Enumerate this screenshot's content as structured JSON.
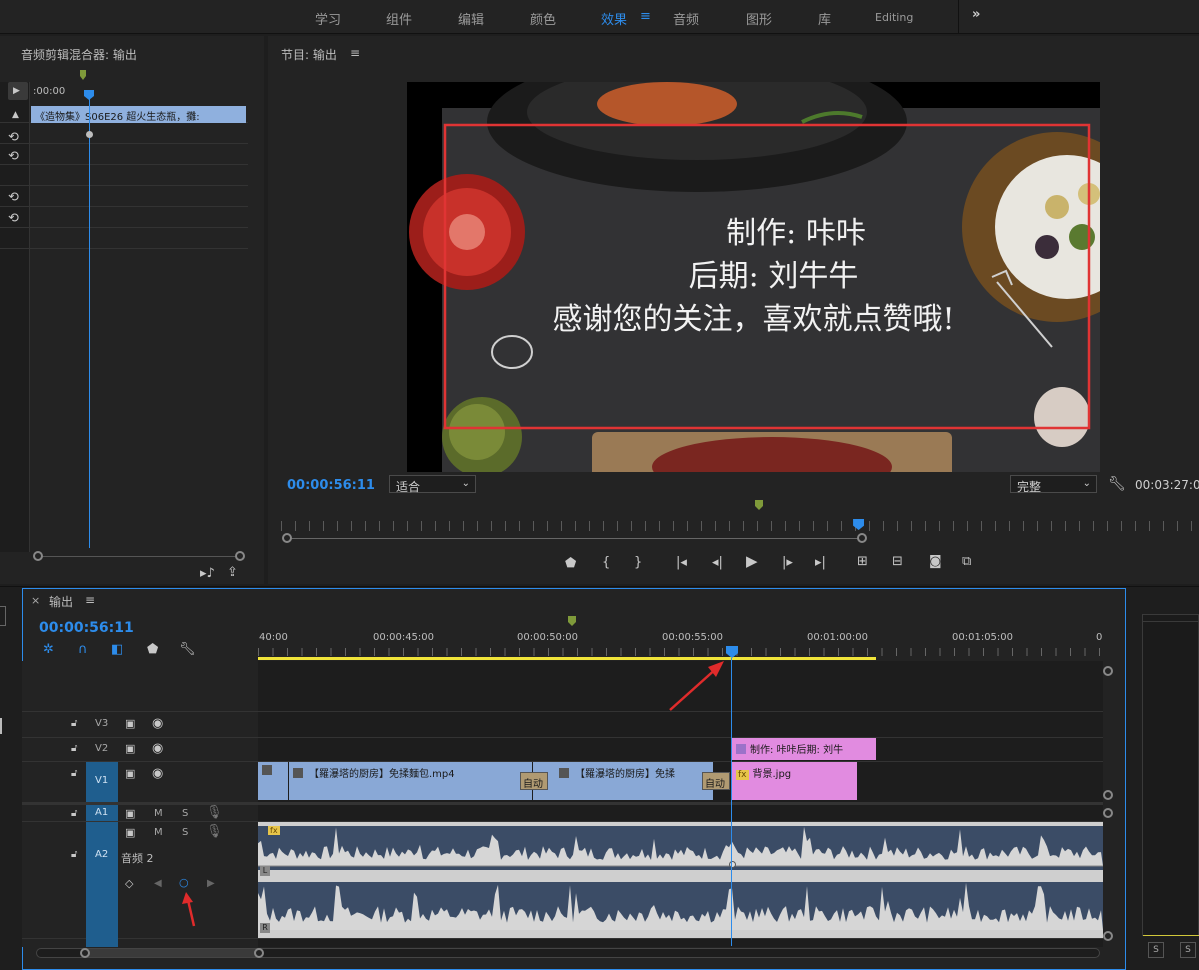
{
  "workspaces": {
    "items": [
      "学习",
      "组件",
      "编辑",
      "颜色",
      "效果",
      "音频",
      "图形",
      "库",
      "Editing"
    ],
    "active_index": 4,
    "more": "»",
    "menu_icon": "≡"
  },
  "audio_mixer": {
    "title": "音频剪辑混合器: 输出",
    "timecode": ":00:00",
    "clip_label": "《造物集》S06E26 超火生态瓶，攤:"
  },
  "program_monitor": {
    "title": "节目: 输出",
    "menu_icon": "≡",
    "overlay_lines": [
      "制作: 咔咔",
      "后期: 刘牛牛",
      "感谢您的关注，喜欢就点赞哦!"
    ],
    "current_timecode": "00:00:56:11",
    "fit_select": "适合",
    "quality_select": "完整",
    "duration": "00:03:27:0",
    "playhead_progress": 0.63
  },
  "timeline": {
    "tab_close": "×",
    "tab_title": "输出",
    "menu_icon": "≡",
    "current_timecode": "00:00:56:11",
    "ruler_labels": [
      "40:00",
      "00:00:45:00",
      "00:00:50:00",
      "00:00:55:00",
      "00:01:00:00",
      "00:01:05:00",
      "0"
    ],
    "tracks": {
      "v3": "V3",
      "v2": "V2",
      "v1": "V1",
      "a1": "A1",
      "a2": "A2",
      "a2_name": "音频 2",
      "m": "M",
      "s": "S"
    },
    "clips": {
      "v2_text": "制作: 咔咔后期: 刘牛",
      "v1_clip1": "【羅瀑塔的厨房】免揉麵包.mp4",
      "v1_clip2": "【羅瀑塔的厨房】免揉",
      "v1_bg": "背景.jpg",
      "transition1": "自动",
      "transition2": "自动",
      "fx": "fx"
    },
    "waveform_labels": {
      "left": "L",
      "right": "R"
    }
  },
  "right_panel": {
    "s1": "S",
    "s2": "S"
  },
  "colors": {
    "accent_blue": "#2d8ceb",
    "video_clip": "#89a8d6",
    "graphic_clip": "#e18be0",
    "waveform_bg": "#3b4c66",
    "highlight_red": "#e03434",
    "work_area_yellow": "#f0e43a",
    "track_header_blue": "#1f5e8e"
  },
  "icons": [
    "double-chevron-right-icon",
    "hamburger-icon",
    "play-triangle-icon",
    "undo-icon",
    "wrench-icon",
    "marker-icon",
    "bracket-in-icon",
    "bracket-out-icon",
    "step-back-icon",
    "play-icon",
    "step-forward-icon",
    "go-to-out-icon",
    "lift-icon",
    "extract-icon",
    "camera-icon",
    "compare-icon",
    "lock-icon",
    "film-icon",
    "eye-icon",
    "mic-icon",
    "snap-icon",
    "magnet-icon",
    "linked-select-icon",
    "keyframe-icon",
    "arrow-left-icon",
    "arrow-right-icon",
    "annotation-arrow-icon"
  ]
}
